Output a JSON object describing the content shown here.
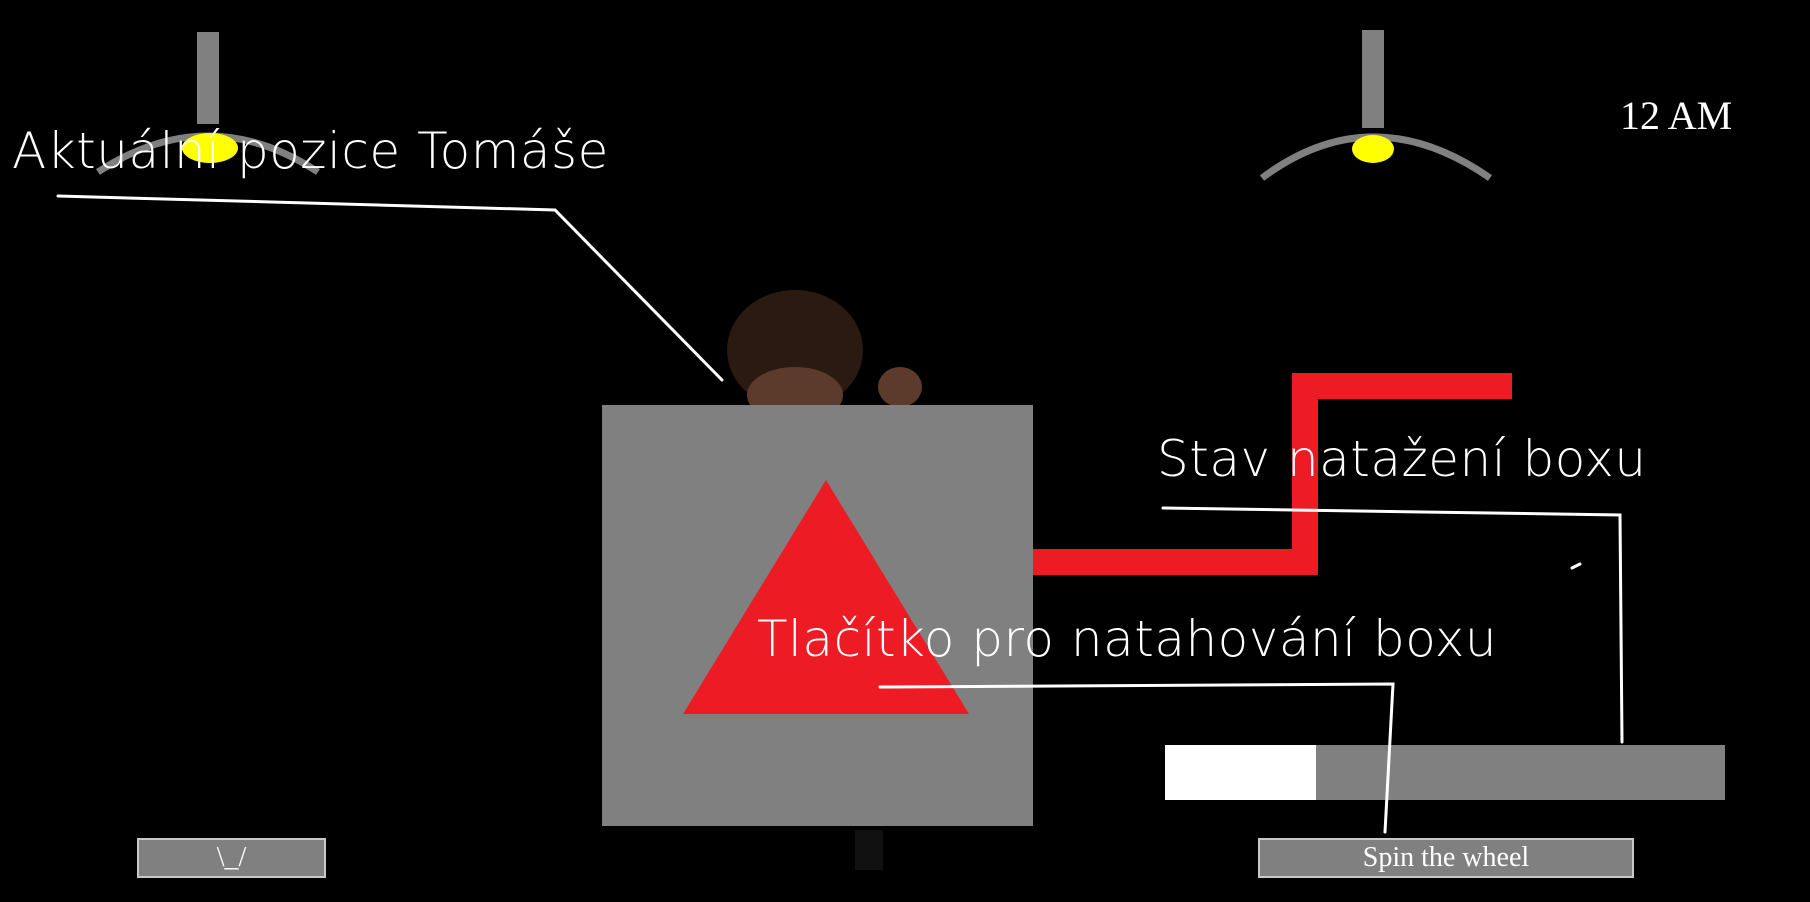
{
  "hud": {
    "clock": "12 AM"
  },
  "controls": {
    "left_button_label": "\\_/",
    "spin_button_label": "Spin the wheel"
  },
  "box": {
    "wind_progress": 0.27
  },
  "annotations": {
    "tomas_position": "Aktuální pozice Tomáše",
    "box_wind_state": "Stav natažení boxu",
    "wind_button": "Tlačítko pro natahování boxu"
  },
  "colors": {
    "background": "#000000",
    "box": "#808080",
    "accent_red": "#ed1c24",
    "lamp_bulb": "#ffff00",
    "progress_fill": "#ffffff"
  }
}
